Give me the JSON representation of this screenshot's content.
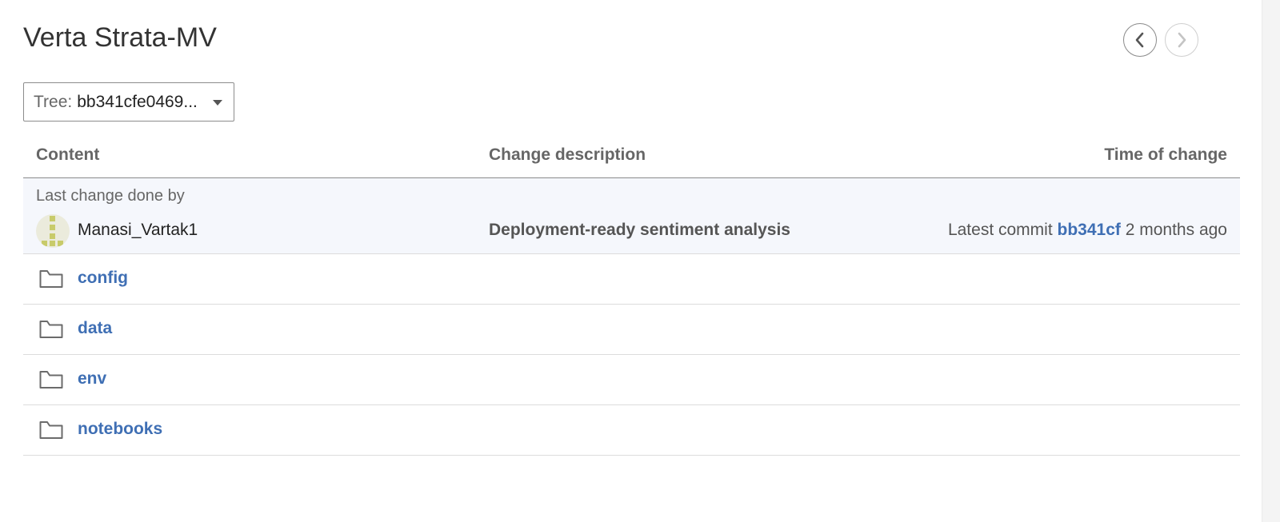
{
  "header": {
    "title": "Verta Strata-MV"
  },
  "navigation": {
    "prev_icon": "chevron-left-icon",
    "next_icon": "chevron-right-icon"
  },
  "tree_selector": {
    "label": "Tree:",
    "value": "bb341cfe0469..."
  },
  "table": {
    "columns": {
      "content": "Content",
      "description": "Change description",
      "time": "Time of change"
    },
    "last_commit": {
      "caption": "Last change done by",
      "author": "Manasi_Vartak1",
      "message": "Deployment-ready sentiment analysis",
      "time_prefix": "Latest commit",
      "hash": "bb341cf",
      "relative_time": "2 months ago"
    },
    "entries": [
      {
        "name": "config",
        "icon": "folder-icon"
      },
      {
        "name": "data",
        "icon": "folder-icon"
      },
      {
        "name": "env",
        "icon": "folder-icon"
      },
      {
        "name": "notebooks",
        "icon": "folder-icon"
      }
    ]
  },
  "colors": {
    "link": "#3f6fb4",
    "commit_row_bg": "#f5f7fc",
    "avatar_accent": "#c8cb6a"
  }
}
